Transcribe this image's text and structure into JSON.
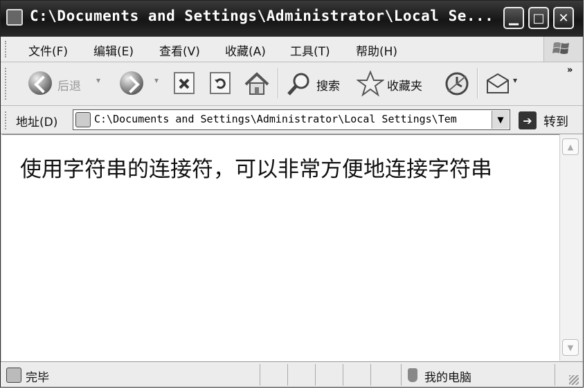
{
  "window": {
    "title": "C:\\Documents and Settings\\Administrator\\Local Se...",
    "min_glyph": "▁",
    "max_glyph": "□",
    "close_glyph": "✕"
  },
  "menu": [
    {
      "label": "文件(F)"
    },
    {
      "label": "编辑(E)"
    },
    {
      "label": "查看(V)"
    },
    {
      "label": "收藏(A)"
    },
    {
      "label": "工具(T)"
    },
    {
      "label": "帮助(H)"
    }
  ],
  "toolbar": {
    "back_label": "后退",
    "search_label": "搜索",
    "favorites_label": "收藏夹",
    "more": "»"
  },
  "address": {
    "label": "地址(D)",
    "value": "C:\\Documents and Settings\\Administrator\\Local Settings\\Tem",
    "go_label": "转到"
  },
  "content": {
    "text": "使用字符串的连接符，可以非常方便地连接字符串"
  },
  "status": {
    "text": "完毕",
    "zone": "我的电脑"
  },
  "colors": {
    "titlebar": "#1a1a1a",
    "chrome": "#ececec",
    "content_bg": "#ffffff"
  }
}
